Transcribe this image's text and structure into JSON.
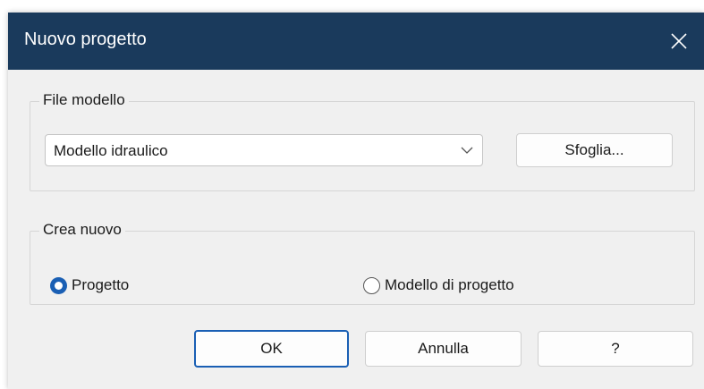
{
  "window": {
    "title": "Nuovo progetto",
    "titlebar_color": "#1a3a5c"
  },
  "template_group": {
    "label": "File modello",
    "selected_template": "Modello idraulico",
    "browse_label": "Sfoglia..."
  },
  "create_group": {
    "label": "Crea nuovo",
    "options": [
      {
        "label": "Progetto",
        "selected": true
      },
      {
        "label": "Modello di progetto",
        "selected": false
      }
    ]
  },
  "buttons": {
    "ok": "OK",
    "cancel": "Annulla",
    "help": "?"
  },
  "colors": {
    "accent": "#1a5fb4",
    "dialog_bg": "#f0f0f0"
  },
  "icons": {
    "close": "close-icon",
    "dropdown": "chevron-down-icon"
  }
}
